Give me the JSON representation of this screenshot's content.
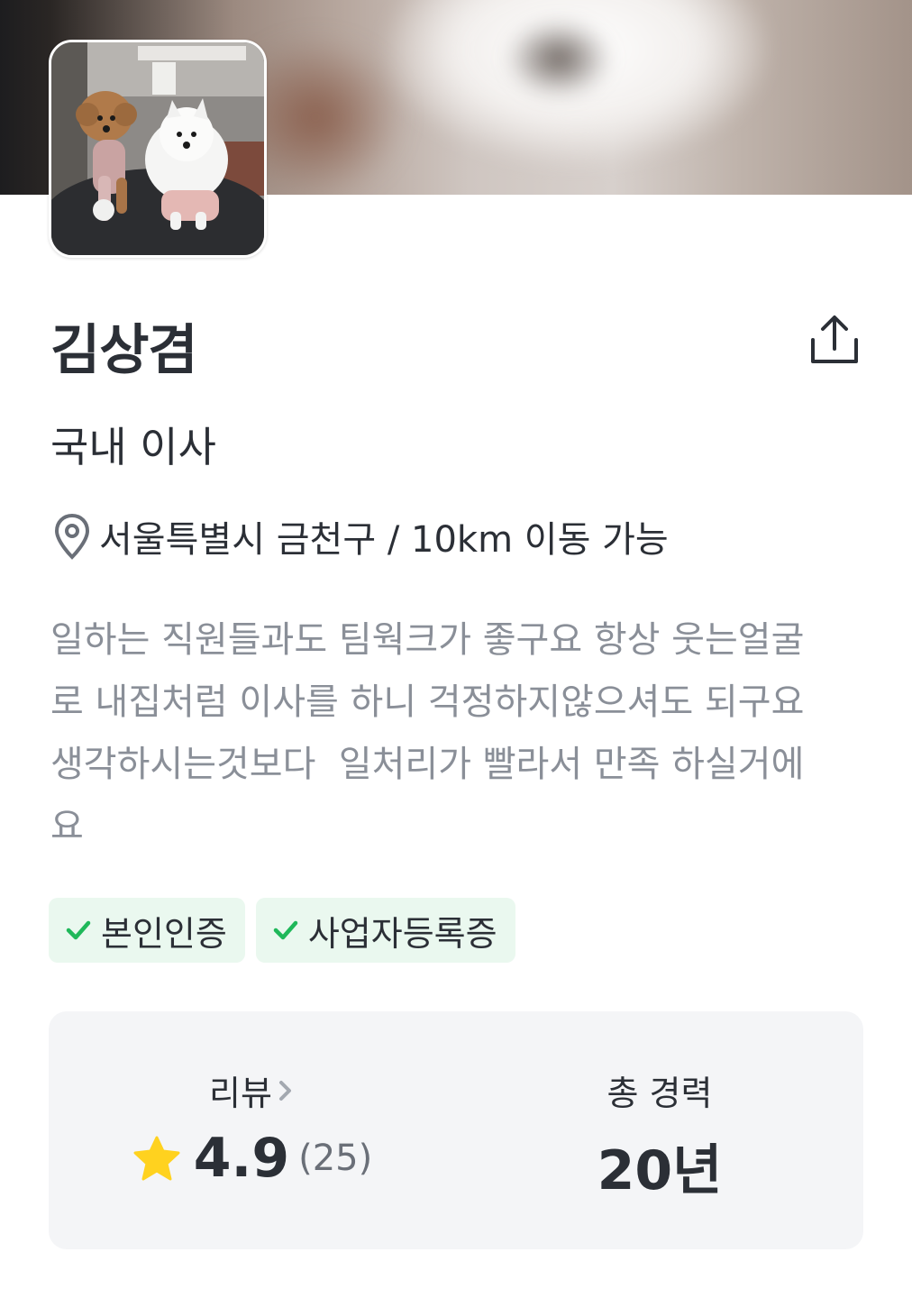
{
  "profile": {
    "name": "김상겸",
    "category": "국내 이사",
    "location": "서울특별시 금천구 / 10km 이동 가능",
    "intro": "일하는 직원들과도 팀웍크가 좋구요 항상 웃는얼굴\n로 내집처럼 이사를 하니 걱정하지않으셔도 되구요\n생각하시는것보다  일처리가 빨라서 만족 하실거에\n요",
    "avatar_icon": "dog-photo",
    "share_icon": "share-icon"
  },
  "badges": [
    {
      "label": "본인인증",
      "icon": "check-icon"
    },
    {
      "label": "사업자등록증",
      "icon": "check-icon"
    }
  ],
  "stats": {
    "review_label": "리뷰",
    "rating": "4.9",
    "review_count": "(25)",
    "career_label": "총 경력",
    "career_value": "20년"
  },
  "colors": {
    "text_primary": "#2b2f36",
    "text_secondary": "#8a8f98",
    "badge_bg": "#eaf8ef",
    "badge_check": "#1fb85a",
    "stats_bg": "#f4f5f7",
    "star": "#ffd21f"
  }
}
